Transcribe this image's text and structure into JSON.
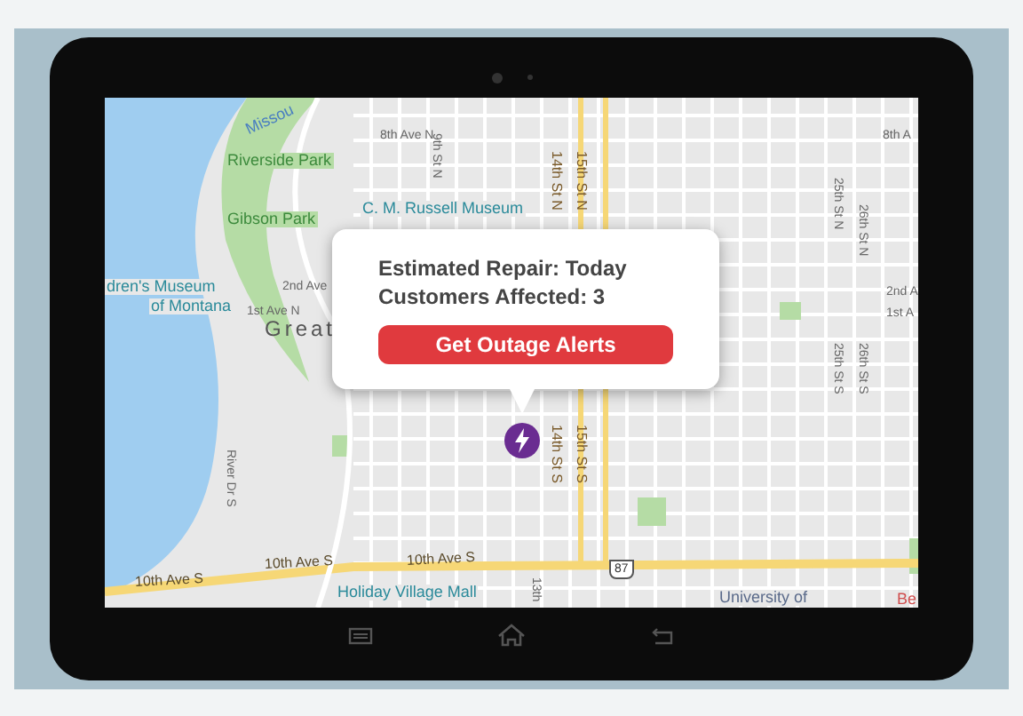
{
  "map_labels": [
    {
      "text": "Missou",
      "kind": "water"
    },
    {
      "text": "8th Ave N",
      "kind": "street"
    },
    {
      "text": "9th St N",
      "kind": "street_v"
    },
    {
      "text": "Riverside Park",
      "kind": "park"
    },
    {
      "text": "Gibson Park",
      "kind": "park"
    },
    {
      "text": "C. M. Russell Museum",
      "kind": "poi"
    },
    {
      "text": "14th St N",
      "kind": "highway_v"
    },
    {
      "text": "15th St N",
      "kind": "highway_v"
    },
    {
      "text": "8th A",
      "kind": "street"
    },
    {
      "text": "25th St N",
      "kind": "street_v"
    },
    {
      "text": "26th St N",
      "kind": "street_v"
    },
    {
      "text": "dren's Museum",
      "kind": "poi"
    },
    {
      "text": "of Montana",
      "kind": "poi_text"
    },
    {
      "text": "2nd Ave",
      "kind": "street"
    },
    {
      "text": "1st Ave N",
      "kind": "street"
    },
    {
      "text": "Great",
      "kind": "city"
    },
    {
      "text": "2nd A",
      "kind": "street"
    },
    {
      "text": "1st A",
      "kind": "street"
    },
    {
      "text": "25th St S",
      "kind": "street_v"
    },
    {
      "text": "26th St S",
      "kind": "street_v"
    },
    {
      "text": "River Dr S",
      "kind": "street_v"
    },
    {
      "text": "14th St S",
      "kind": "highway_v"
    },
    {
      "text": "15th St S",
      "kind": "highway_v"
    },
    {
      "text": "10th Ave S",
      "kind": "highway"
    },
    {
      "text": "10th Ave S",
      "kind": "highway"
    },
    {
      "text": "10th Ave S",
      "kind": "highway"
    },
    {
      "text": "87",
      "kind": "shield"
    },
    {
      "text": "Holiday Village Mall",
      "kind": "poi"
    },
    {
      "text": "13th",
      "kind": "street_v"
    },
    {
      "text": "University of",
      "kind": "poi_text"
    },
    {
      "text": "Be",
      "kind": "poi_red"
    }
  ],
  "popup": {
    "line_1": "Estimated Repair: Today",
    "line_2": "Customers Affected: 3",
    "button": "Get Outage Alerts"
  }
}
